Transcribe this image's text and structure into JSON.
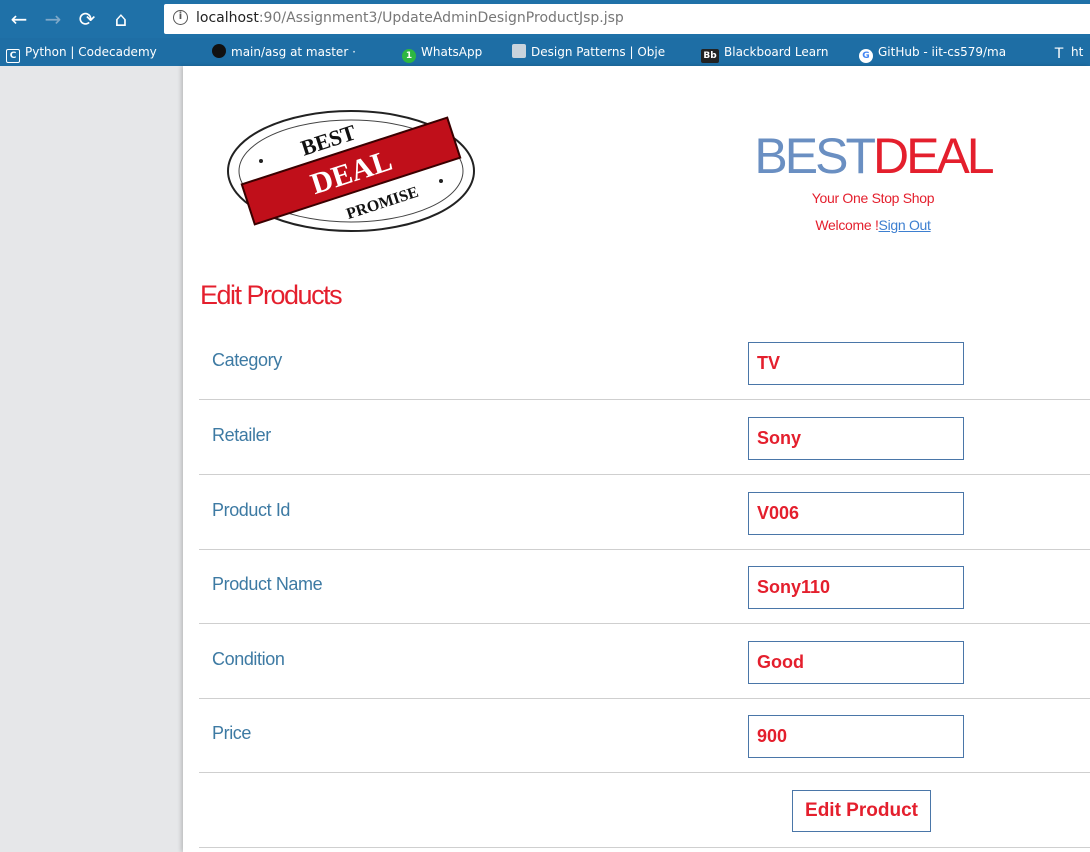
{
  "browser": {
    "url_host": "localhost",
    "url_path": ":90/Assignment3/UpdateAdminDesignProductJsp.jsp",
    "bookmarks": [
      {
        "label": "Python | Codecademy",
        "icon": "codecademy-icon"
      },
      {
        "label": "main/asg at master · ",
        "icon": "github-icon"
      },
      {
        "label": "WhatsApp",
        "icon": "whatsapp-icon"
      },
      {
        "label": "Design Patterns | Obje",
        "icon": "design-patterns-icon"
      },
      {
        "label": "Blackboard Learn",
        "icon": "blackboard-icon"
      },
      {
        "label": "GitHub - iit-cs579/ma",
        "icon": "google-icon"
      },
      {
        "label": "ht",
        "icon": "text-icon"
      }
    ],
    "whatsapp_badge": "1",
    "blackboard_badge": "Bb",
    "codecademy_badge": "C"
  },
  "logo": {
    "top": "BEST",
    "middle": "DEAL",
    "bottom": "PROMISE"
  },
  "brand": {
    "title_part1": "BEST",
    "title_part2": "DEAL",
    "tagline": "Your One Stop Shop",
    "welcome": "Welcome !",
    "signout": "Sign Out"
  },
  "page": {
    "heading": "Edit Products"
  },
  "form": {
    "fields": [
      {
        "label": "Category",
        "value": "TV"
      },
      {
        "label": "Retailer",
        "value": "Sony"
      },
      {
        "label": "Product Id",
        "value": "V006"
      },
      {
        "label": "Product Name",
        "value": "Sony110"
      },
      {
        "label": "Condition",
        "value": "Good"
      },
      {
        "label": "Price",
        "value": "900"
      }
    ],
    "submit_label": "Edit Product"
  },
  "colors": {
    "chrome_blue": "#1f71a8",
    "accent_red": "#e41f2d",
    "label_blue": "#3d7aa3",
    "brand_blue": "#6a8fc2"
  }
}
